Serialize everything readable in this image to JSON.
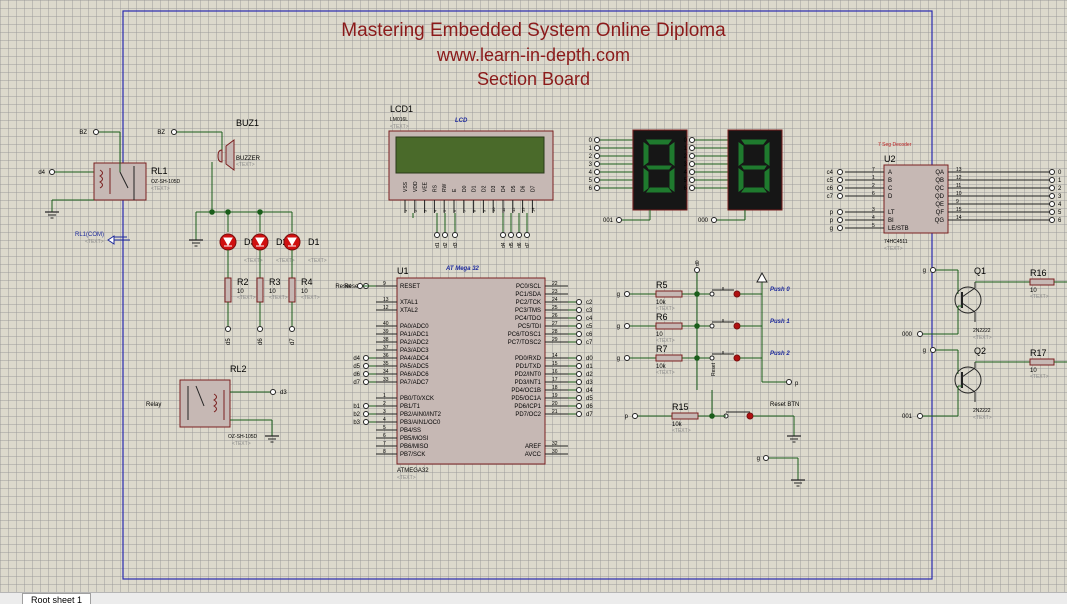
{
  "title": {
    "line1": "Mastering Embedded System Online Diploma",
    "line2": "www.learn-in-depth.com",
    "line3": "Section Board",
    "color": "#8b1a1a"
  },
  "colors": {
    "wire": "#1a5d1a",
    "body": "#c6b8b4",
    "outline": "#7a1f1f",
    "label": "#000000",
    "accent": "#1d2a9c",
    "led": "#cc1111",
    "frame": "#2a2ab0"
  },
  "text_placeholder": "<TEXT>",
  "tab": {
    "label": "Root sheet 1"
  },
  "lcd": {
    "ref": "LCD1",
    "part": "LM016L",
    "tag": "LCD",
    "pins": [
      "VSS",
      "VDD",
      "VEE",
      "RS",
      "RW",
      "E",
      "D0",
      "D1",
      "D2",
      "D3",
      "D4",
      "D5",
      "D6",
      "D7"
    ],
    "pin_numbers": [
      "1",
      "2",
      "3",
      "4",
      "5",
      "6",
      "7",
      "8",
      "9",
      "10",
      "11",
      "12",
      "13",
      "14"
    ],
    "nets": [
      "d1",
      "d2",
      "d3",
      "d4",
      "d5",
      "d6",
      "d7"
    ]
  },
  "buzzer": {
    "ref": "BUZ1",
    "part": "BUZZER",
    "net": "BZ"
  },
  "relay1": {
    "ref": "RL1",
    "part": "OZ-SH-105D",
    "net_in": "d4",
    "com": "RL1(COM)",
    "bz": "BZ"
  },
  "relay2": {
    "ref": "RL2",
    "part": "OZ-SH-105D",
    "label": "Relay",
    "net": "d3"
  },
  "leds": [
    {
      "ref": "D3"
    },
    {
      "ref": "D2"
    },
    {
      "ref": "D1"
    }
  ],
  "resistors_led": [
    {
      "ref": "R2",
      "value": "10",
      "net": "d5"
    },
    {
      "ref": "R3",
      "value": "10",
      "net": "d6"
    },
    {
      "ref": "R4",
      "value": "10",
      "net": "d7"
    }
  ],
  "mcu": {
    "ref": "U1",
    "title": "AT Mega 32",
    "part": "ATMEGA32",
    "left_pins": [
      {
        "num": "9",
        "name": "RESET",
        "net": "Reset"
      },
      {
        "num": "13",
        "name": "XTAL1",
        "net": ""
      },
      {
        "num": "12",
        "name": "XTAL2",
        "net": ""
      },
      {
        "num": "40",
        "name": "PA0/ADC0",
        "net": ""
      },
      {
        "num": "39",
        "name": "PA1/ADC1",
        "net": ""
      },
      {
        "num": "38",
        "name": "PA2/ADC2",
        "net": ""
      },
      {
        "num": "37",
        "name": "PA3/ADC3",
        "net": ""
      },
      {
        "num": "36",
        "name": "PA4/ADC4",
        "net": "d4"
      },
      {
        "num": "35",
        "name": "PA5/ADC5",
        "net": "d5"
      },
      {
        "num": "34",
        "name": "PA6/ADC6",
        "net": "d6"
      },
      {
        "num": "33",
        "name": "PA7/ADC7",
        "net": "d7"
      },
      {
        "num": "1",
        "name": "PB0/T0/XCK",
        "net": ""
      },
      {
        "num": "2",
        "name": "PB1/T1",
        "net": "b1"
      },
      {
        "num": "3",
        "name": "PB2/AIN0/INT2",
        "net": "b2"
      },
      {
        "num": "4",
        "name": "PB3/AIN1/OC0",
        "net": "b3"
      },
      {
        "num": "5",
        "name": "PB4/SS",
        "net": ""
      },
      {
        "num": "6",
        "name": "PB5/MOSI",
        "net": ""
      },
      {
        "num": "7",
        "name": "PB6/MISO",
        "net": ""
      },
      {
        "num": "8",
        "name": "PB7/SCK",
        "net": ""
      }
    ],
    "right_pins": [
      {
        "num": "22",
        "name": "PC0/SCL",
        "net": ""
      },
      {
        "num": "23",
        "name": "PC1/SDA",
        "net": ""
      },
      {
        "num": "24",
        "name": "PC2/TCK",
        "net": "c2"
      },
      {
        "num": "25",
        "name": "PC3/TMS",
        "net": "c3"
      },
      {
        "num": "26",
        "name": "PC4/TDO",
        "net": "c4"
      },
      {
        "num": "27",
        "name": "PC5/TDI",
        "net": "c5"
      },
      {
        "num": "28",
        "name": "PC6/TOSC1",
        "net": "c6"
      },
      {
        "num": "29",
        "name": "PC7/TOSC2",
        "net": "c7"
      },
      {
        "num": "14",
        "name": "PD0/RXD",
        "net": "d0"
      },
      {
        "num": "15",
        "name": "PD1/TXD",
        "net": "d1"
      },
      {
        "num": "16",
        "name": "PD2/INT0",
        "net": "d2"
      },
      {
        "num": "17",
        "name": "PD3/INT1",
        "net": "d3"
      },
      {
        "num": "18",
        "name": "PD4/OC1B",
        "net": "d4"
      },
      {
        "num": "19",
        "name": "PD5/OC1A",
        "net": "d5"
      },
      {
        "num": "20",
        "name": "PD6/ICP1",
        "net": "d6"
      },
      {
        "num": "21",
        "name": "PD7/OC2",
        "net": "d7"
      },
      {
        "num": "32",
        "name": "AREF",
        "net": ""
      },
      {
        "num": "30",
        "name": "AVCC",
        "net": ""
      }
    ]
  },
  "seven_seg": [
    {
      "inputs": [
        "0",
        "1",
        "2",
        "3",
        "4",
        "5",
        "6"
      ],
      "common": "001"
    },
    {
      "inputs": [
        "0",
        "1",
        "2",
        "3",
        "4",
        "5",
        "6"
      ],
      "common": "000"
    }
  ],
  "decoder": {
    "ref": "U2",
    "title": "7 Seg Decoder",
    "part": "74HC4511",
    "left_pins": [
      {
        "num": "7",
        "name": "A",
        "net": "c4"
      },
      {
        "num": "1",
        "name": "B",
        "net": "c5"
      },
      {
        "num": "2",
        "name": "C",
        "net": "c6"
      },
      {
        "num": "6",
        "name": "D",
        "net": "c7"
      },
      {
        "num": "3",
        "name": "LT",
        "net": "p"
      },
      {
        "num": "4",
        "name": "BI",
        "net": "p"
      },
      {
        "num": "5",
        "name": "LE/STB",
        "net": "g"
      }
    ],
    "right_pins": [
      {
        "num": "13",
        "name": "QA",
        "net": "0"
      },
      {
        "num": "12",
        "name": "QB",
        "net": "1"
      },
      {
        "num": "11",
        "name": "QC",
        "net": "2"
      },
      {
        "num": "10",
        "name": "QD",
        "net": "3"
      },
      {
        "num": "9",
        "name": "QE",
        "net": "4"
      },
      {
        "num": "15",
        "name": "QF",
        "net": "5"
      },
      {
        "num": "14",
        "name": "QG",
        "net": "6"
      }
    ]
  },
  "push_buttons": [
    {
      "ref": "R5",
      "value": "10k",
      "label": "Push 0",
      "net": "g"
    },
    {
      "ref": "R6",
      "value": "10",
      "label": "Push 1",
      "net": "g"
    },
    {
      "ref": "R7",
      "value": "10k",
      "label": "Push 2",
      "net": "g"
    }
  ],
  "reset": {
    "ref": "R15",
    "value": "10k",
    "label": "Reset BTN",
    "net_left": "p",
    "net_side": "Reset"
  },
  "misc_nets": {
    "d0": "d0",
    "p": "p",
    "g": "g"
  },
  "transistors": [
    {
      "ref": "Q1",
      "part": "2N2222",
      "base_net": "000",
      "gate_net": "g",
      "res_ref": "R16",
      "res_value": "10"
    },
    {
      "ref": "Q2",
      "part": "2N2222",
      "base_net": "001",
      "gate_net": "g",
      "res_ref": "R17",
      "res_value": "10"
    }
  ]
}
